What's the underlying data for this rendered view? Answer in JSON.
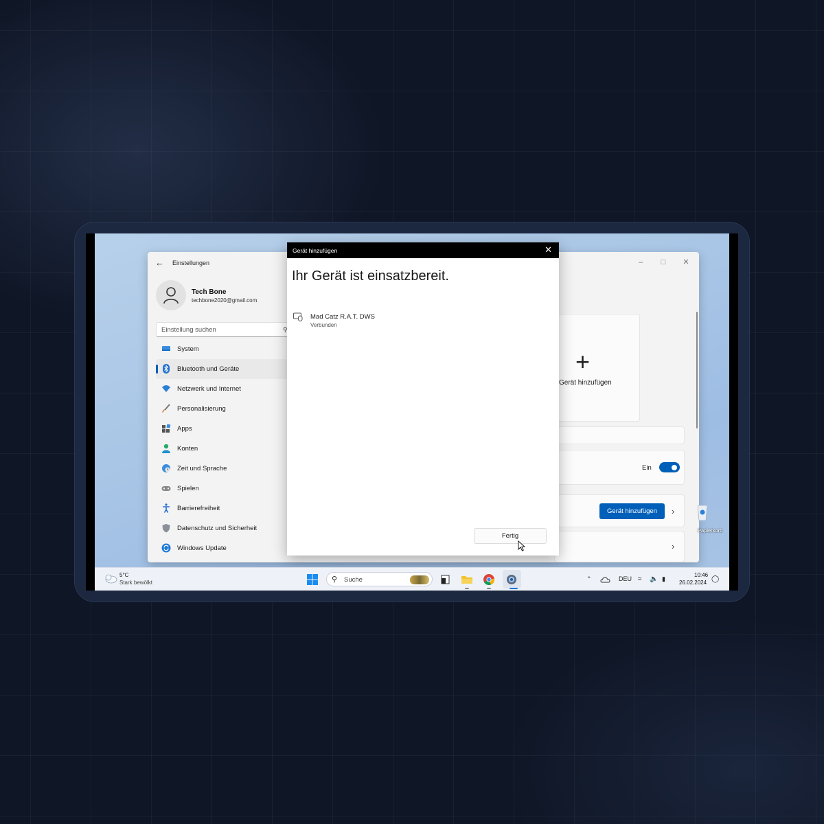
{
  "settings": {
    "title": "Einstellungen",
    "user": {
      "name": "Tech Bone",
      "email": "techbone2020@gmail.com"
    },
    "search_placeholder": "Einstellung suchen",
    "nav": [
      {
        "label": "System",
        "icon": "monitor-icon"
      },
      {
        "label": "Bluetooth und Geräte",
        "icon": "bluetooth-icon",
        "active": true
      },
      {
        "label": "Netzwerk und Internet",
        "icon": "wifi-icon"
      },
      {
        "label": "Personalisierung",
        "icon": "brush-icon"
      },
      {
        "label": "Apps",
        "icon": "apps-icon"
      },
      {
        "label": "Konten",
        "icon": "person-icon"
      },
      {
        "label": "Zeit und Sprache",
        "icon": "globe-clock-icon"
      },
      {
        "label": "Spielen",
        "icon": "gamepad-icon"
      },
      {
        "label": "Barrierefreiheit",
        "icon": "accessibility-icon"
      },
      {
        "label": "Datenschutz und Sicherheit",
        "icon": "shield-icon"
      },
      {
        "label": "Windows Update",
        "icon": "update-icon"
      }
    ],
    "add_card_label": "Gerät hinzufügen",
    "bluetooth_toggle_label": "Ein",
    "add_device_button": "Gerät hinzufügen"
  },
  "dialog": {
    "title": "Gerät hinzufügen",
    "heading": "Ihr Gerät ist einsatzbereit.",
    "device_name": "Mad Catz R.A.T. DWS",
    "device_status": "Verbunden",
    "done_button": "Fertig"
  },
  "desktop": {
    "recycle_label": "Papierkorb"
  },
  "taskbar": {
    "weather_temp": "5°C",
    "weather_desc": "Stark bewölkt",
    "search_label": "Suche",
    "language": "DEU",
    "time": "10:46",
    "date": "26.02.2024"
  },
  "colors": {
    "accent": "#005fb8",
    "dialog_titlebar": "#000000"
  }
}
